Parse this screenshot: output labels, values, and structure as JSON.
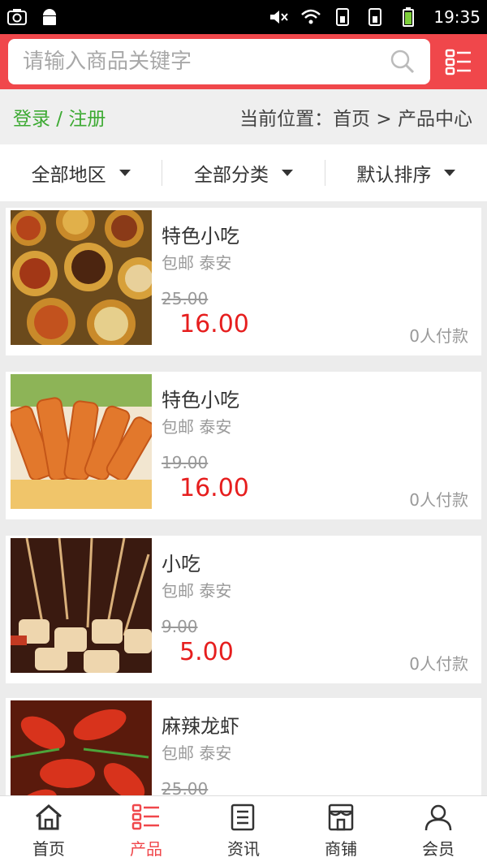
{
  "status_bar": {
    "time": "19:35",
    "left_icons": [
      "camera-icon",
      "android-icon"
    ],
    "right_icons": [
      "mute-icon",
      "wifi-icon",
      "sim1-icon",
      "sim2-icon",
      "battery-icon"
    ]
  },
  "search": {
    "placeholder": "请输入商品关键字",
    "search_icon": "search-icon",
    "menu_icon": "list-menu-icon"
  },
  "breadcrumb": {
    "login": "登录 / 注册",
    "location": "当前位置：首页 > 产品中心"
  },
  "filters": [
    {
      "label": "全部地区"
    },
    {
      "label": "全部分类"
    },
    {
      "label": "默认排序"
    }
  ],
  "products": [
    {
      "title": "特色小吃",
      "sub": "包邮 泰安",
      "old_price": "25.00",
      "price": "16.00",
      "paid": "0人付款",
      "image": "dim-sum-steamers"
    },
    {
      "title": "特色小吃",
      "sub": "包邮 泰安",
      "old_price": "19.00",
      "price": "16.00",
      "paid": "0人付款",
      "image": "spicy-rice-cakes"
    },
    {
      "title": "小吃",
      "sub": "包邮 泰安",
      "old_price": "9.00",
      "price": "5.00",
      "paid": "0人付款",
      "image": "skewers"
    },
    {
      "title": "麻辣龙虾",
      "sub": "包邮 泰安",
      "old_price": "25.00",
      "price": "",
      "paid": "",
      "image": "spicy-crayfish"
    }
  ],
  "bottom_nav": [
    {
      "label": "首页",
      "icon": "home-icon"
    },
    {
      "label": "产品",
      "icon": "products-icon",
      "active": true
    },
    {
      "label": "资讯",
      "icon": "news-icon"
    },
    {
      "label": "商铺",
      "icon": "shop-icon"
    },
    {
      "label": "会员",
      "icon": "member-icon"
    }
  ],
  "colors": {
    "brand": "#f0474b",
    "price": "#e61e1e",
    "login": "#3daa33"
  }
}
